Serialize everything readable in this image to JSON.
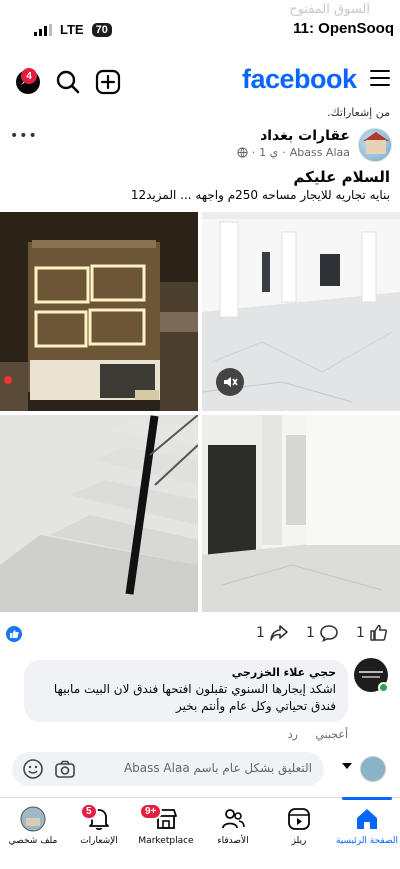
{
  "status_bar": {
    "time": "11:",
    "carrier": "OpenSooq",
    "watermark": "السوق المفتوح",
    "battery": "70",
    "network": "LTE"
  },
  "header": {
    "brand": "facebook",
    "messenger_badge": "4"
  },
  "from_notifications": "من إشعاراتك.",
  "post": {
    "page_name": "عقارات بغداد",
    "author": "Abass Alaa",
    "time": "1 ي",
    "title": "السلام عليكم",
    "description": "بنايه تجاريه للايجار مساحه 250م واجهه ... المزيد12",
    "reactions": {
      "likes": "1",
      "comments": "1",
      "shares": "1"
    }
  },
  "comment": {
    "author": "حجي علاء الخزرجي",
    "text": "اشكد إيجارها السنوي تقبلون افتحها فندق لان البيت مابيها فندق تحياتي وكل عام وأنتم بخير",
    "like_label": "أعجبني",
    "reply_label": "رد"
  },
  "composer": {
    "placeholder": "التعليق بشكل عام باسم Abass Alaa"
  },
  "bottom_nav": {
    "items": [
      {
        "label": "الصفحة الرئيسية",
        "icon": "home-icon",
        "active": true
      },
      {
        "label": "ريلز",
        "icon": "reels-icon"
      },
      {
        "label": "الأصدقاء",
        "icon": "friends-icon"
      },
      {
        "label": "Marketplace",
        "icon": "marketplace-icon",
        "badge": "9+"
      },
      {
        "label": "الإشعارات",
        "icon": "bell-icon",
        "badge": "5"
      },
      {
        "label": "ملف شخصي",
        "icon": "profile-icon"
      }
    ]
  },
  "colors": {
    "brand_blue": "#0866ff",
    "badge_red": "#e41e3f",
    "online_green": "#31a24c"
  }
}
